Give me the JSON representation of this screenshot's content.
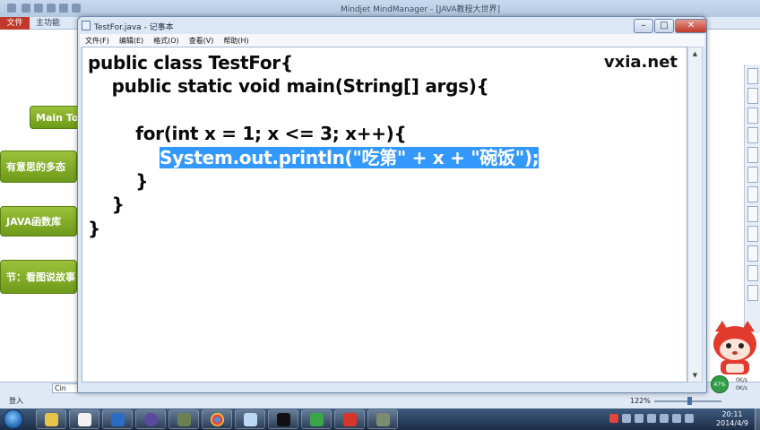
{
  "background_app": {
    "title": "Mindjet MindManager - [JAVA教程大世界]",
    "ribbon": {
      "file_tab": "文件",
      "main_tab": "主功能"
    },
    "topics": [
      {
        "label": "Main To"
      },
      {
        "label": "有意思的多态"
      },
      {
        "label": "JAVA函数库"
      },
      {
        "label": "节：看图说故事"
      }
    ],
    "sheet_tab": "Cin",
    "status_left": "登入",
    "zoom": "122%"
  },
  "notepad": {
    "title": "TestFor.java - 记事本",
    "menus": [
      "文件(F)",
      "编辑(E)",
      "格式(O)",
      "查看(V)",
      "帮助(H)"
    ],
    "watermark": "vxia.net",
    "code": {
      "line1": "public class TestFor{",
      "line2": "    public static void main(String[] args){",
      "line3": "",
      "line4": "        for(int x = 1; x <= 3; x++){",
      "line5_indent": "            ",
      "line5_selected": "System.out.println(\"吃第\" + x + \"碗饭\");",
      "line6": "        }",
      "line7": "    }",
      "line8": "}"
    },
    "controls": {
      "minimize": "–",
      "maximize": "□",
      "close": "✕"
    }
  },
  "net_meter": {
    "percent": "47%",
    "up": "0K/s",
    "down": "0K/s"
  },
  "taskbar": {
    "apps": [
      "explorer",
      "media",
      "outlook",
      "eclipse",
      "picture",
      "chrome",
      "notepad",
      "cmd",
      "shield",
      "mindmanager",
      "video"
    ],
    "clock_time": "20:11",
    "clock_date": "2014/4/9"
  },
  "colors": {
    "topic_green": "#7aa620",
    "selection_blue": "#3399ff",
    "file_tab_red": "#c0392b"
  }
}
